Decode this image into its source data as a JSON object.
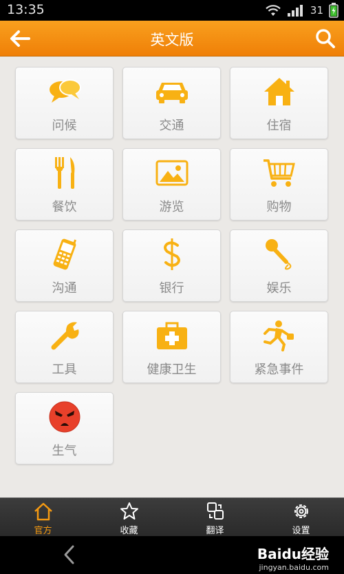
{
  "status_bar": {
    "time": "13:35",
    "battery_level": "31"
  },
  "header": {
    "title": "英文版"
  },
  "categories": [
    {
      "label": "问候",
      "icon": "speech-bubbles-icon"
    },
    {
      "label": "交通",
      "icon": "car-icon"
    },
    {
      "label": "住宿",
      "icon": "house-icon"
    },
    {
      "label": "餐饮",
      "icon": "fork-knife-icon"
    },
    {
      "label": "游览",
      "icon": "picture-icon"
    },
    {
      "label": "购物",
      "icon": "cart-icon"
    },
    {
      "label": "沟通",
      "icon": "phone-icon"
    },
    {
      "label": "银行",
      "icon": "dollar-icon"
    },
    {
      "label": "娱乐",
      "icon": "microphone-icon"
    },
    {
      "label": "工具",
      "icon": "wrench-icon"
    },
    {
      "label": "健康卫生",
      "icon": "first-aid-kit-icon"
    },
    {
      "label": "紧急事件",
      "icon": "running-man-icon"
    },
    {
      "label": "生气",
      "icon": "angry-face-icon"
    }
  ],
  "tabbar": {
    "tabs": [
      {
        "label": "官方",
        "icon": "home-icon",
        "active": true
      },
      {
        "label": "收藏",
        "icon": "star-icon",
        "active": false
      },
      {
        "label": "翻译",
        "icon": "translate-icon",
        "active": false
      },
      {
        "label": "设置",
        "icon": "gear-icon",
        "active": false
      }
    ]
  },
  "watermark": {
    "main": "Baidu经验",
    "sub": "jingyan.baidu.com"
  },
  "colors": {
    "accent": "#f5a00f",
    "header": "#f28a0c",
    "icon": "#f8b113",
    "label": "#8a8a8a",
    "tab_active": "#f59a12"
  }
}
